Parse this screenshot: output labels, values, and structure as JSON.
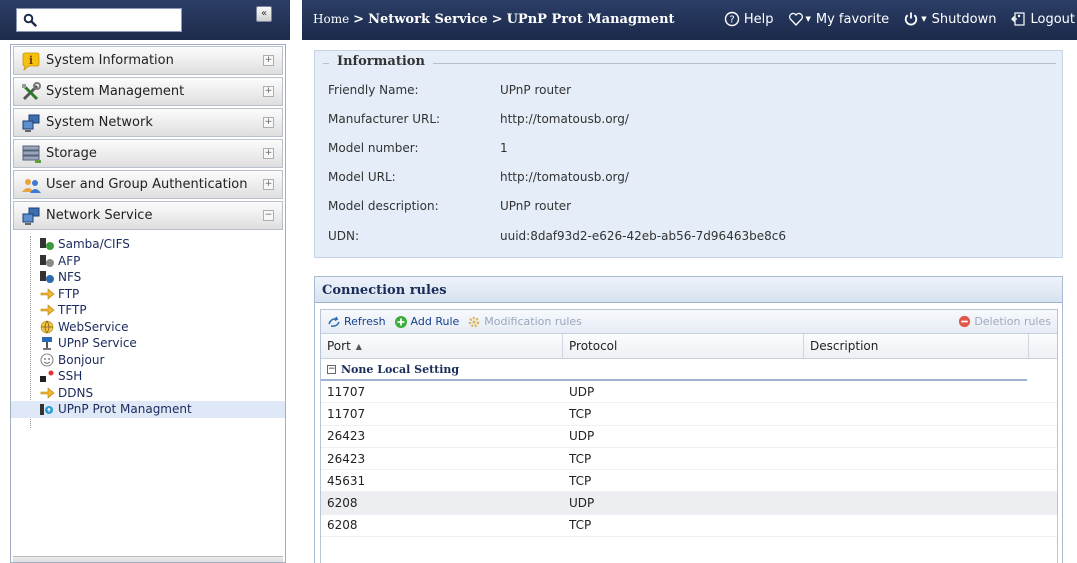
{
  "search": {
    "placeholder": ""
  },
  "collapse_label": "«",
  "breadcrumb": {
    "home": "Home",
    "sep": ">",
    "section": "Network Service",
    "page": "UPnP Prot Managment"
  },
  "toplinks": {
    "help": "Help",
    "favorite": "My favorite",
    "shutdown": "Shutdown",
    "logout": "Logout"
  },
  "nav": {
    "headers": [
      {
        "label": "System Information",
        "icon": "info-icon"
      },
      {
        "label": "System Management",
        "icon": "tools-icon"
      },
      {
        "label": "System Network",
        "icon": "network-icon"
      },
      {
        "label": "Storage",
        "icon": "storage-icon"
      },
      {
        "label": "User and Group Authentication",
        "icon": "users-icon"
      },
      {
        "label": "Network Service",
        "icon": "network-service-icon"
      }
    ],
    "expand_symbol": "+",
    "collapse_symbol": "−",
    "sub_items": [
      {
        "label": "Samba/CIFS",
        "icon": "samba-icon"
      },
      {
        "label": "AFP",
        "icon": "afp-icon"
      },
      {
        "label": "NFS",
        "icon": "nfs-icon"
      },
      {
        "label": "FTP",
        "icon": "ftp-icon"
      },
      {
        "label": "TFTP",
        "icon": "tftp-icon"
      },
      {
        "label": "WebService",
        "icon": "webservice-icon"
      },
      {
        "label": "UPnP Service",
        "icon": "upnp-service-icon"
      },
      {
        "label": "Bonjour",
        "icon": "bonjour-icon"
      },
      {
        "label": "SSH",
        "icon": "ssh-icon"
      },
      {
        "label": "DDNS",
        "icon": "ddns-icon"
      },
      {
        "label": "UPnP Prot Managment",
        "icon": "upnp-port-icon"
      }
    ]
  },
  "info": {
    "title": "Information",
    "rows": [
      {
        "label": "Friendly Name:",
        "value": "UPnP router"
      },
      {
        "label": "Manufacturer URL:",
        "value": "http://tomatousb.org/"
      },
      {
        "label": "Model number:",
        "value": "1"
      },
      {
        "label": "Model URL:",
        "value": "http://tomatousb.org/"
      },
      {
        "label": "Model description:",
        "value": "UPnP router"
      },
      {
        "label": "UDN:",
        "value": "uuid:8daf93d2-e626-42eb-ab56-7d96463be8c6"
      }
    ]
  },
  "rules": {
    "title": "Connection rules",
    "toolbar": {
      "refresh": "Refresh",
      "add": "Add Rule",
      "modify": "Modification rules",
      "delete": "Deletion rules"
    },
    "columns": {
      "port": "Port",
      "protocol": "Protocol",
      "description": "Description"
    },
    "group_title": "None Local Setting",
    "rows": [
      {
        "port": "11707",
        "protocol": "UDP",
        "description": ""
      },
      {
        "port": "11707",
        "protocol": "TCP",
        "description": ""
      },
      {
        "port": "26423",
        "protocol": "UDP",
        "description": ""
      },
      {
        "port": "26423",
        "protocol": "TCP",
        "description": ""
      },
      {
        "port": "45631",
        "protocol": "TCP",
        "description": ""
      },
      {
        "port": "6208",
        "protocol": "UDP",
        "description": ""
      },
      {
        "port": "6208",
        "protocol": "TCP",
        "description": ""
      }
    ]
  },
  "colors": {
    "topbar": "#1f2c4d",
    "panel_bg": "#e4edf8",
    "link": "#15418c",
    "active_row": "#eceef1"
  }
}
